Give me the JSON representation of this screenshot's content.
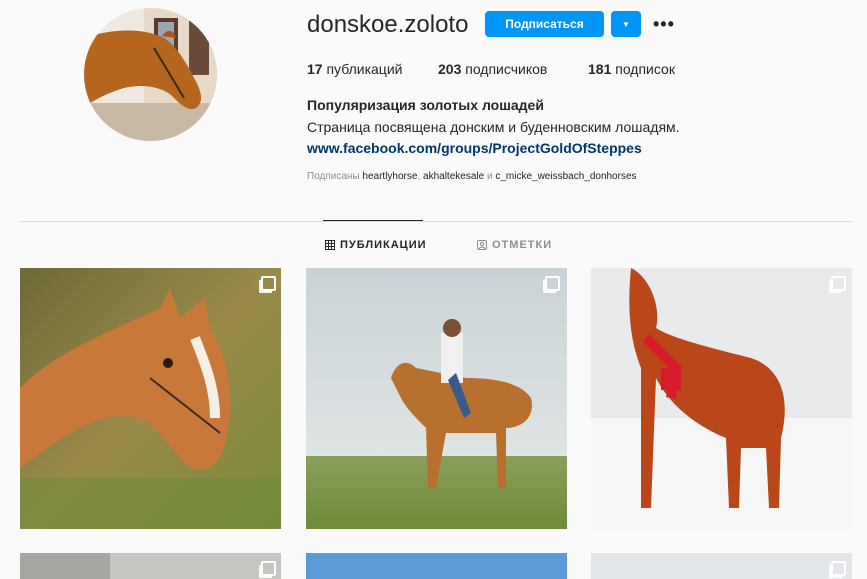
{
  "profile": {
    "username": "donskoe.zoloto",
    "follow_label": "Подписаться",
    "stats": {
      "posts_count": "17",
      "posts_label": "публикаций",
      "followers_count": "203",
      "followers_label": "подписчиков",
      "following_count": "181",
      "following_label": "подписок"
    },
    "bio_name": "Популяризация золотых лошадей",
    "bio_text": "Страница посвящена донским и буденновским лошадям.",
    "bio_link": "www.facebook.com/groups/ProjectGoldOfSteppes",
    "followed_by_prefix": "Подписаны",
    "followed_by": [
      "heartlyhorse",
      "akhaltekesale",
      "c_micke_weissbach_donhorses"
    ],
    "followed_sep": ",",
    "followed_and": "и"
  },
  "tabs": {
    "posts_label": "ПУБЛИКАЦИИ",
    "tagged_label": "ОТМЕТКИ"
  },
  "icons": {
    "grid": "grid-icon",
    "tag": "tag-icon",
    "dropdown": "chevron-down-icon",
    "more": "more-icon",
    "multi": "carousel-icon"
  },
  "colors": {
    "accent": "#0095f6",
    "link": "#00376b"
  }
}
